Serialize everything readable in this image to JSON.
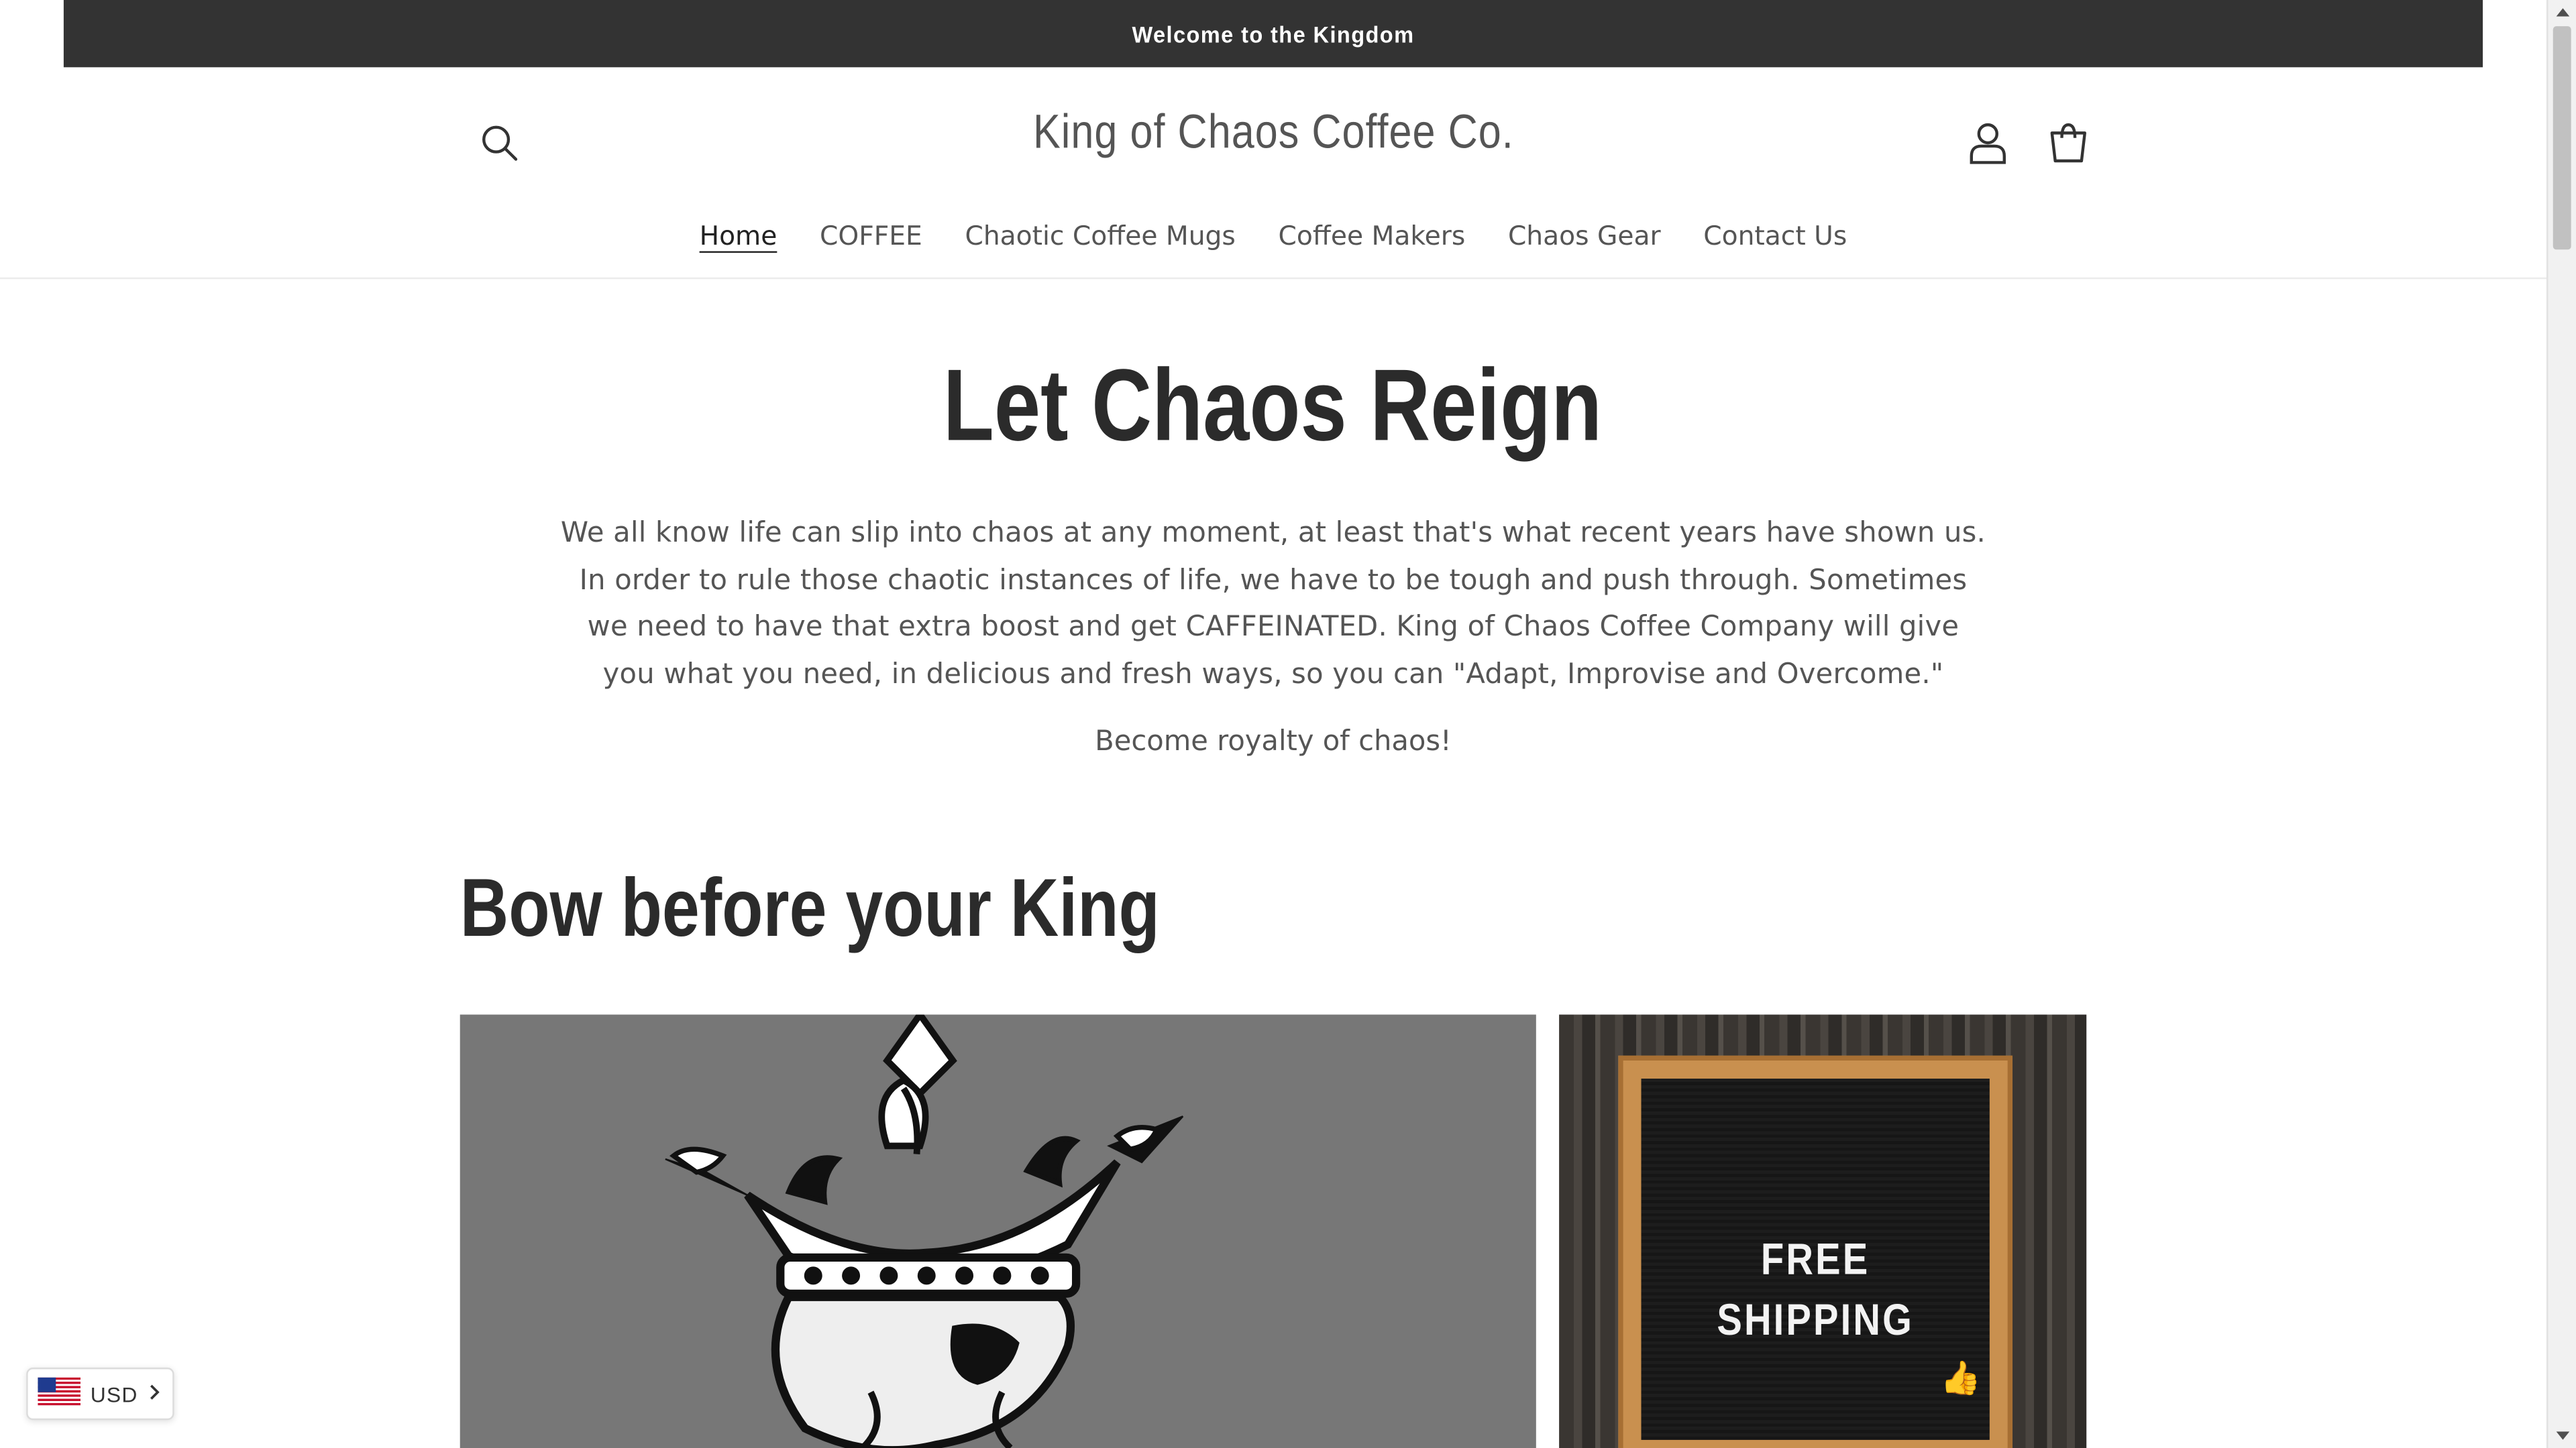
{
  "announcement": "Welcome to the Kingdom",
  "brand": "King of Chaos Coffee Co.",
  "nav": [
    "Home",
    "COFFEE",
    "Chaotic Coffee Mugs",
    "Coffee Makers",
    "Chaos Gear",
    "Contact Us"
  ],
  "hero": {
    "title": "Let Chaos Reign",
    "body": "We all know life can slip into chaos at any moment, at least that's what recent years have shown us. In order to rule those chaotic instances of life, we have to be tough and push through. Sometimes we need to have that extra boost and get CAFFEINATED. King of Chaos Coffee Company will give you what you need, in delicious and fresh ways, so you can \"Adapt, Improvise and Overcome.\"",
    "tagline": "Become royalty of chaos!"
  },
  "section_title": "Bow before your King",
  "promo_board": [
    "FREE",
    "SHIPPING"
  ],
  "currency": "USD",
  "colors": {
    "announcement_bg": "#333333",
    "text": "#333333",
    "muted": "#555555",
    "hero_image_bg": "#777777"
  }
}
